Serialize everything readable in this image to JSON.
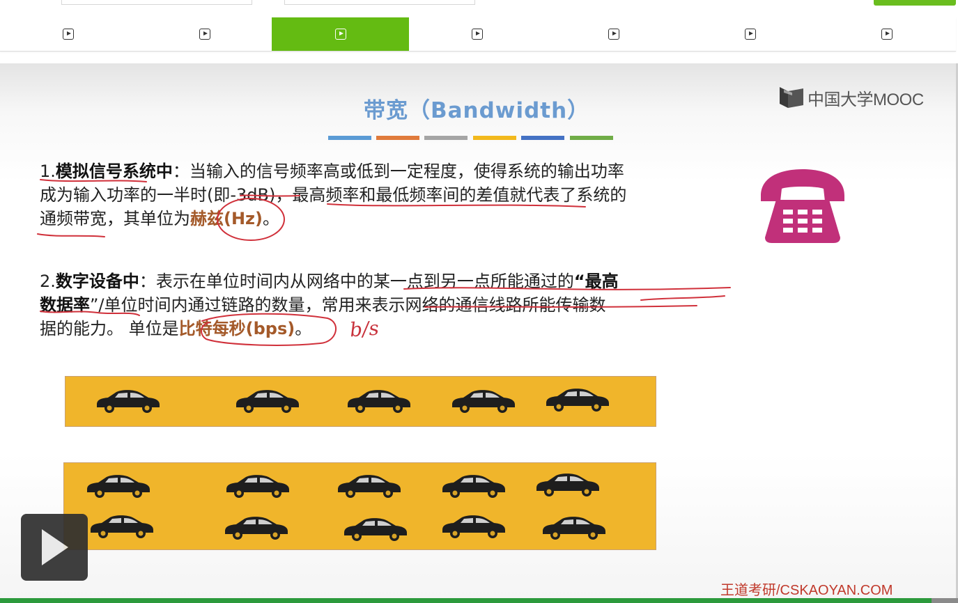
{
  "player": {
    "segment_count": 7,
    "active_segment": 3,
    "segments": [
      "",
      "",
      "",
      "",
      "",
      "",
      ""
    ]
  },
  "slide": {
    "title": "带宽（Bandwidth）",
    "logo_text": "中国大学MOOC",
    "stripe_colors": [
      "#5b9bd5",
      "#e07b3c",
      "#a5a5a5",
      "#f2b91d",
      "#4472c4",
      "#70ad47"
    ],
    "p1": {
      "lead": "1.",
      "term": "模拟信号系统中",
      "line1": "：当输入的信号频率高或低到一定程度，使得系统的输出功率",
      "line2": "成为输入功率的一半时(即-3dB)，最高频率和最低频率间的差值就代表了系统的",
      "line3a": "通频带宽，其单位为",
      "unit": "赫兹(Hz)",
      "line3b": "。"
    },
    "p2": {
      "lead": "2.",
      "term": "数字设备中",
      "line1a": "：表示在单位时间内从网络中的某一点到另一点所能通过的",
      "quote_a": "“最高",
      "quote_b": "数据率",
      "line2": "”/单位时间内通过链路的数量，常用来表示网络的通信线路所能传输数",
      "line3a": "据的能力。 单位是",
      "unit": "比特每秒(bps)",
      "line3b": "。"
    },
    "annotation": "b/s",
    "phone_color": "#c1307a",
    "road_color": "#f0b52b",
    "watermark": "王道考研/CSKAOYAN.COM"
  },
  "progress": {
    "value": 0.97
  }
}
